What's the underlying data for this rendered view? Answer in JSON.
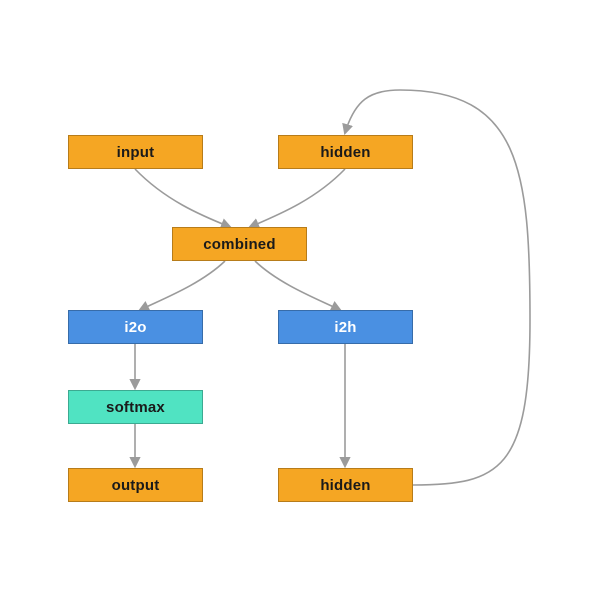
{
  "nodes": {
    "input": {
      "label": "input"
    },
    "hidden0": {
      "label": "hidden"
    },
    "combined": {
      "label": "combined"
    },
    "i2o": {
      "label": "i2o"
    },
    "i2h": {
      "label": "i2h"
    },
    "softmax": {
      "label": "softmax"
    },
    "output": {
      "label": "output"
    },
    "hidden1": {
      "label": "hidden"
    }
  },
  "colors": {
    "orange": "#f5a623",
    "blue": "#4a90e2",
    "mint": "#50e3c2",
    "edge": "#9b9b9b"
  }
}
